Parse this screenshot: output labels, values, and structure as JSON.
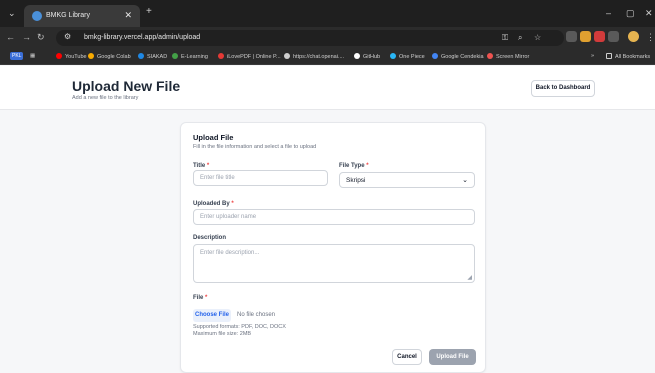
{
  "browser": {
    "tab_title": "BMKG Library",
    "url": "bmkg-library.vercel.app/admin/upload",
    "bookmarks": [
      {
        "label": "YouTube",
        "color": "#ff0000"
      },
      {
        "label": "Google Colab",
        "color": "#f9ab00"
      },
      {
        "label": "SIAKAD",
        "color": "#1e88e5"
      },
      {
        "label": "E-Learning",
        "color": "#43a047"
      },
      {
        "label": "iLovePDF | Online P...",
        "color": "#e53935"
      },
      {
        "label": "https://chat.openai....",
        "color": "#cfcfcf"
      },
      {
        "label": "GitHub",
        "color": "#ffffff"
      },
      {
        "label": "One Piece",
        "color": "#29b6f6"
      },
      {
        "label": "Google Cendekia",
        "color": "#4285f4"
      },
      {
        "label": "Screen Mirror",
        "color": "#ef5350"
      }
    ],
    "pkl_label": "PKL",
    "all_bookmarks": "All Bookmarks",
    "more": "»"
  },
  "header": {
    "title": "Upload New File",
    "subtitle": "Add a new file to the library",
    "back_label": "Back to Dashboard"
  },
  "form": {
    "title": "Upload File",
    "subtitle": "Fill in the file information and select a file to upload",
    "title_label": "Title",
    "title_placeholder": "Enter file title",
    "filetype_label": "File Type",
    "filetype_value": "Skripsi",
    "uploader_label": "Uploaded By",
    "uploader_placeholder": "Enter uploader name",
    "description_label": "Description",
    "description_placeholder": "Enter file description...",
    "file_label": "File",
    "choose_label": "Choose File",
    "no_file": "No file chosen",
    "formats": "Supported formats: PDF, DOC, DOCX",
    "maxsize": "Maximum file size: 2MB",
    "cancel_label": "Cancel",
    "upload_label": "Upload File"
  },
  "required_mark": "*"
}
